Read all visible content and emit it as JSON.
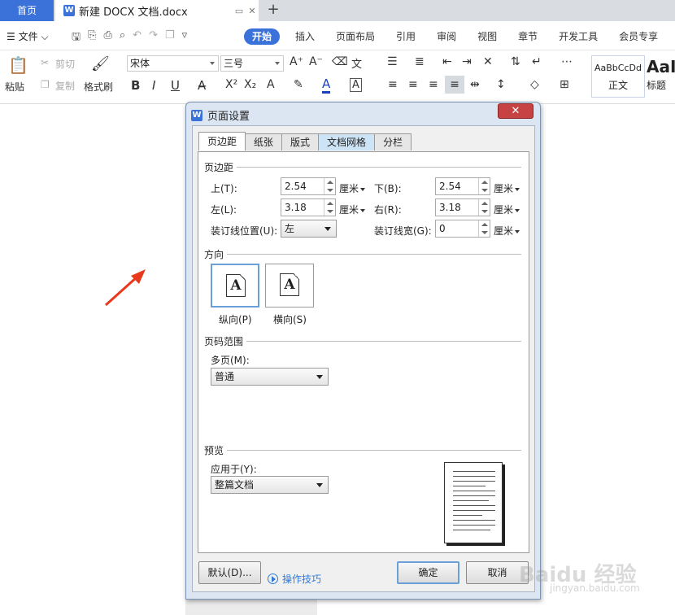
{
  "tabs": {
    "home": "首页",
    "doc_title": "新建 DOCX 文档.docx"
  },
  "menu": {
    "file": "文件",
    "items": [
      "开始",
      "插入",
      "页面布局",
      "引用",
      "审阅",
      "视图",
      "章节",
      "开发工具",
      "会员专享"
    ]
  },
  "ribbon": {
    "paste": "粘贴",
    "cut": "剪切",
    "copy": "复制",
    "format_painter": "格式刷",
    "font": "宋体",
    "size": "三号",
    "style1_sample": "AaBbCcDd",
    "style1_name": "正文",
    "style2_sample": "AaI",
    "style2_name": "标题"
  },
  "dialog": {
    "title": "页面设置",
    "tabs": [
      "页边距",
      "纸张",
      "版式",
      "文档网格",
      "分栏"
    ],
    "margins_section": "页边距",
    "top_label": "上(T):",
    "top_value": "2.54",
    "bottom_label": "下(B):",
    "bottom_value": "2.54",
    "left_label": "左(L):",
    "left_value": "3.18",
    "right_label": "右(R):",
    "right_value": "3.18",
    "gutter_pos_label": "装订线位置(U):",
    "gutter_pos_value": "左",
    "gutter_width_label": "装订线宽(G):",
    "gutter_width_value": "0",
    "unit": "厘米",
    "orientation_section": "方向",
    "portrait": "纵向(P)",
    "landscape": "横向(S)",
    "orient_glyph": "A",
    "pages_section": "页码范围",
    "multi_pages_label": "多页(M):",
    "multi_pages_value": "普通",
    "preview_section": "预览",
    "apply_label": "应用于(Y):",
    "apply_value": "整篇文档",
    "default_btn": "默认(D)...",
    "tips": "操作技巧",
    "ok": "确定",
    "cancel": "取消"
  },
  "watermark": {
    "main": "Baidu 经验",
    "sub": "jingyan.baidu.com"
  },
  "colors": {
    "accent": "#3b72d9",
    "arrow": "#e8391c",
    "close": "#c74343"
  }
}
